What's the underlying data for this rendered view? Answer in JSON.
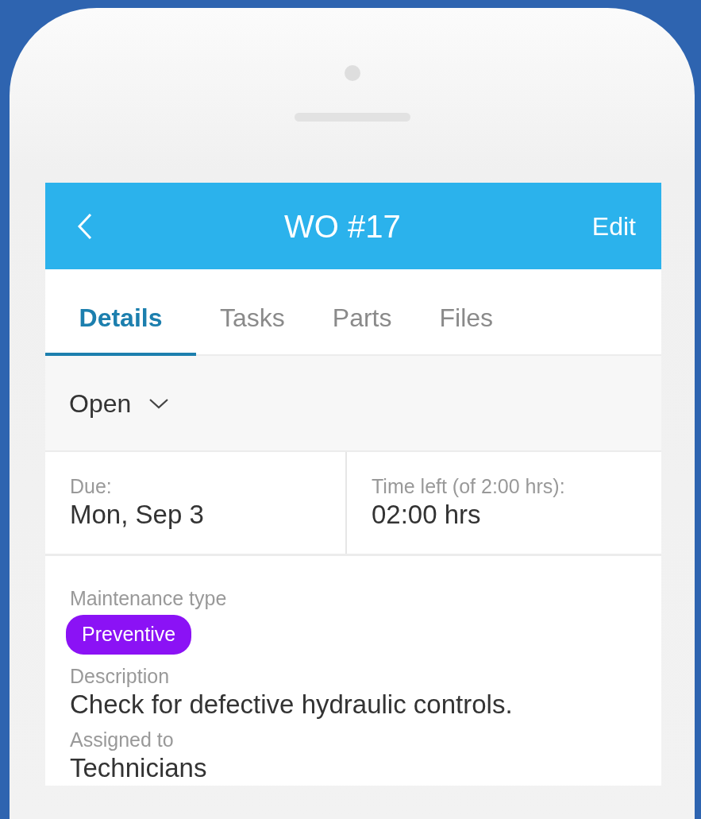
{
  "header": {
    "title": "WO #17",
    "action": "Edit"
  },
  "tabs": [
    {
      "label": "Details",
      "selected": true
    },
    {
      "label": "Tasks",
      "selected": false
    },
    {
      "label": "Parts",
      "selected": false
    },
    {
      "label": "Files",
      "selected": false
    }
  ],
  "status": {
    "value": "Open"
  },
  "summary": [
    {
      "label": "Due:",
      "value": "Mon, Sep 3"
    },
    {
      "label": "Time left (of 2:00 hrs):",
      "value": "02:00 hrs"
    }
  ],
  "fields": [
    {
      "kind": "badge",
      "label": "Maintenance type",
      "value": "Preventive"
    },
    {
      "kind": "text",
      "label": "Description",
      "value": "Check for defective hydraulic controls."
    },
    {
      "kind": "text",
      "label": "Assigned to",
      "value": "Technicians"
    }
  ]
}
